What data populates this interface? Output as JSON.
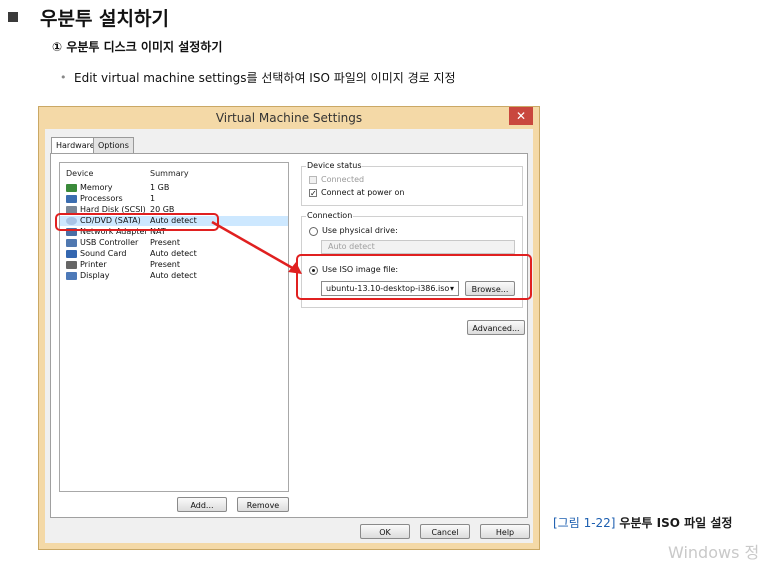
{
  "slide": {
    "heading": "우분투 설치하기",
    "subheading": "① 우분투 디스크 이미지 설정하기",
    "bullet": "Edit virtual machine settings를 선택하여 ISO 파일의 이미지 경로 지정"
  },
  "dialog": {
    "title": "Virtual Machine Settings",
    "tabs": [
      {
        "label": "Hardware"
      },
      {
        "label": "Options"
      }
    ],
    "device_list": {
      "header_device": "Device",
      "header_summary": "Summary",
      "rows": [
        {
          "name": "Memory",
          "summary": "1 GB",
          "icon": "memory-icon"
        },
        {
          "name": "Processors",
          "summary": "1",
          "icon": "cpu-icon"
        },
        {
          "name": "Hard Disk (SCSI)",
          "summary": "20 GB",
          "icon": "hard-disk-icon"
        },
        {
          "name": "CD/DVD (SATA)",
          "summary": "Auto detect",
          "icon": "cd-dvd-icon",
          "selected": true
        },
        {
          "name": "Network Adapter",
          "summary": "NAT",
          "icon": "network-icon"
        },
        {
          "name": "USB Controller",
          "summary": "Present",
          "icon": "usb-icon"
        },
        {
          "name": "Sound Card",
          "summary": "Auto detect",
          "icon": "speaker-icon"
        },
        {
          "name": "Printer",
          "summary": "Present",
          "icon": "printer-icon"
        },
        {
          "name": "Display",
          "summary": "Auto detect",
          "icon": "display-icon"
        }
      ]
    },
    "buttons": {
      "add": "Add...",
      "remove": "Remove",
      "ok": "OK",
      "cancel": "Cancel",
      "help": "Help",
      "browse": "Browse...",
      "advanced": "Advanced..."
    },
    "device_status": {
      "label": "Device status",
      "connected": "Connected",
      "connect_at_power_on": "Connect at power on"
    },
    "connection": {
      "label": "Connection",
      "use_physical_drive": "Use physical drive:",
      "physical_drive_value": "Auto detect",
      "use_iso": "Use ISO image file:",
      "iso_value": "ubuntu-13.10-desktop-i386.iso"
    }
  },
  "caption": {
    "figure": "[그림 1-22]",
    "text": "우분투 ISO 파일 설정"
  },
  "watermark": "Windows 정"
}
